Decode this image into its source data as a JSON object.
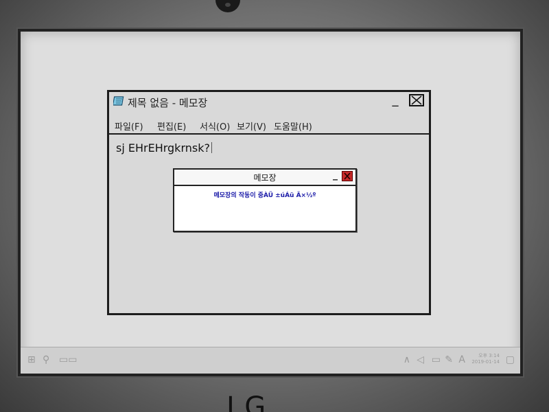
{
  "notepad": {
    "title": "제목 없음 - 메모장",
    "menu": [
      {
        "label": "파일(F)"
      },
      {
        "label": "편집(E)"
      },
      {
        "label": "서식(O)"
      },
      {
        "label": "보기(V)"
      },
      {
        "label": "도움말(H)"
      }
    ],
    "text_content": "sj EHrEHrgkrnsk?"
  },
  "dialog": {
    "title": "메모장",
    "message": "메모장의 작동이 중ÀÜ ±úÁü Ã×½º",
    "close_color": "#c62828",
    "message_color": "#1a1aa8"
  },
  "taskbar": {
    "clock_line1": "오후 3:14",
    "clock_line2": "2019-01-14"
  },
  "brand": "LG",
  "icons": {
    "notepad_app": "notepad-icon",
    "minimize": "minimize-icon",
    "close": "close-icon"
  }
}
